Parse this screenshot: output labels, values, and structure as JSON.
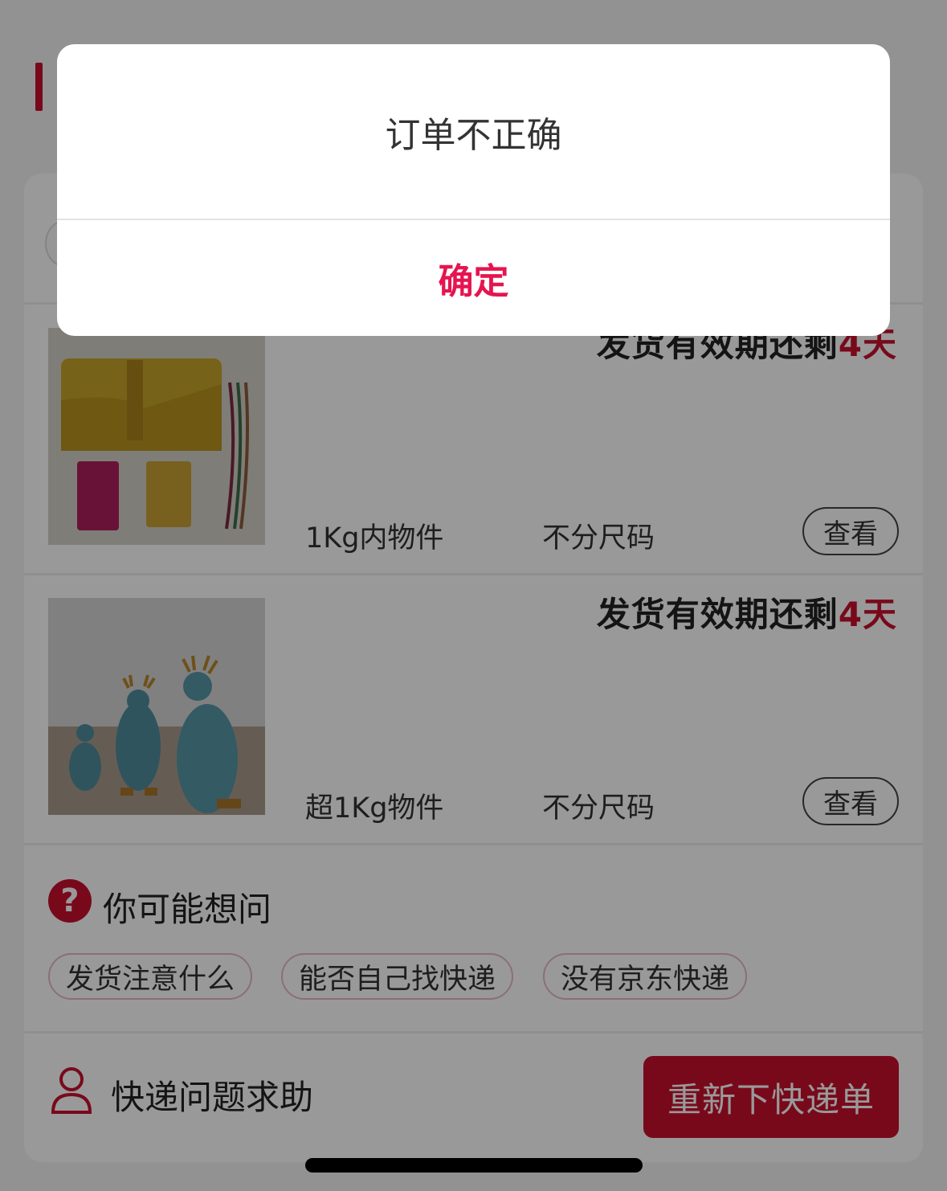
{
  "dialog": {
    "message": "订单不正确",
    "confirm_label": "确定"
  },
  "items": [
    {
      "deadline_prefix": "发货有效期还剩",
      "deadline_days": "4天",
      "weight": "1Kg内物件",
      "size": "不分尺码",
      "view_label": "查看",
      "image": "yellow-leather-bag-and-wallets"
    },
    {
      "deadline_prefix": "发货有效期还剩",
      "deadline_days": "4天",
      "weight": "超1Kg物件",
      "size": "不分尺码",
      "view_label": "查看",
      "image": "blue-deer-figurines"
    }
  ],
  "faq": {
    "icon": "question-icon",
    "title": "你可能想问",
    "chips": [
      "发货注意什么",
      "能否自己找快递",
      "没有京东快递"
    ]
  },
  "footer": {
    "help_icon": "person-icon",
    "help_label": "快递问题求助",
    "reorder_label": "重新下快递单"
  },
  "colors": {
    "accent": "#c8102e",
    "confirm": "#e5154f",
    "overlay": "rgba(0,0,0,0.4)"
  }
}
